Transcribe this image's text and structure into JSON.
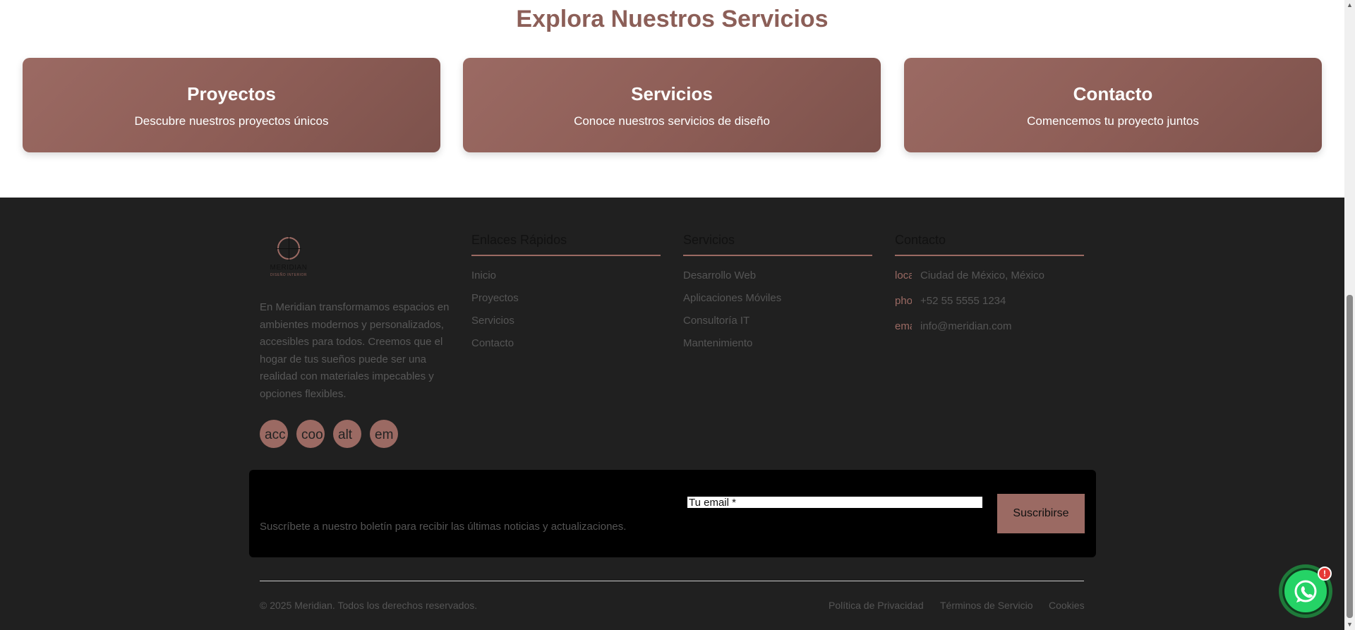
{
  "services": {
    "title": "Explora Nuestros Servicios",
    "cards": [
      {
        "title": "Proyectos",
        "description": "Descubre nuestros proyectos únicos"
      },
      {
        "title": "Servicios",
        "description": "Conoce nuestros servicios de diseño"
      },
      {
        "title": "Contacto",
        "description": "Comencemos tu proyecto juntos"
      }
    ]
  },
  "footer": {
    "logo": {
      "name": "MERIDIAN",
      "subtitle": "DISEÑO INTERIOR"
    },
    "about": "En Meridian transformamos espacios en ambientes modernos y personalizados, accesibles para todos. Creemos que el hogar de tus sueños puede ser una realidad con materiales impecables y opciones flexibles.",
    "social": [
      "acc",
      "coo",
      "alt",
      "em"
    ],
    "quick_links": {
      "title": "Enlaces Rápidos",
      "items": [
        "Inicio",
        "Proyectos",
        "Servicios",
        "Contacto"
      ]
    },
    "services": {
      "title": "Servicios",
      "items": [
        "Desarrollo Web",
        "Aplicaciones Móviles",
        "Consultoría IT",
        "Mantenimiento"
      ]
    },
    "contact": {
      "title": "Contacto",
      "items": [
        {
          "icon": "location",
          "text": "Ciudad de México, México"
        },
        {
          "icon": "phone",
          "text": "+52 55 5555 1234"
        },
        {
          "icon": "email",
          "text": "info@meridian.com"
        }
      ]
    },
    "newsletter": {
      "text": "Suscríbete a nuestro boletín para recibir las últimas noticias y actualizaciones.",
      "placeholder": "Tu email *",
      "button": "Suscribirse"
    },
    "copyright": "© 2025 Meridian. Todos los derechos reservados.",
    "legal": [
      "Política de Privacidad",
      "Términos de Servicio",
      "Cookies"
    ]
  },
  "whatsapp": {
    "badge": "!"
  },
  "colors": {
    "accent": "#9b6a63",
    "footer_bg": "#202020",
    "title": "#8c5f58",
    "whatsapp": "#25d366"
  }
}
